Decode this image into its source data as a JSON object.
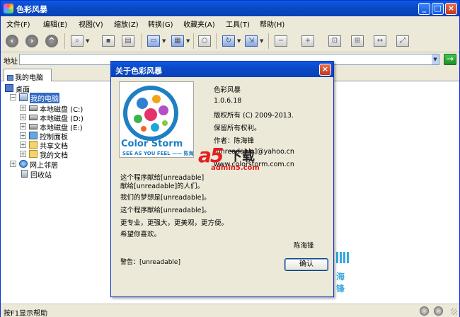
{
  "window": {
    "title": "色彩风暴"
  },
  "menu": [
    "文件(F)",
    "编辑(E)",
    "视图(V)",
    "缩放(Z)",
    "转换(G)",
    "收藏夹(A)",
    "工具(T)",
    "帮助(H)"
  ],
  "address": {
    "label": "地址",
    "value": "",
    "go_icon": "arrow-right-icon"
  },
  "tab": {
    "label": "我的电脑"
  },
  "tree": {
    "desktop": "桌面",
    "computer": "我的电脑",
    "drives": [
      "本地磁盘 (C:)",
      "本地磁盘 (D:)",
      "本地磁盘 (E:)"
    ],
    "control_panel": "控制面板",
    "shared_docs": "共享文档",
    "my_docs": "我的文档",
    "network": "网上邻居",
    "recycle": "回收站"
  },
  "status": {
    "text": "按F1显示帮助"
  },
  "dialog": {
    "title": "关于色彩风暴",
    "app_name": "色彩风暴",
    "version": "1.0.6.18",
    "copyright": "版权所有 (C) 2009-2013.",
    "rights": "保留所有权利。",
    "author": "作者：陈海锋",
    "email": "[unreadable]@yahoo.cn",
    "site": "www.colorstorm.com.cn",
    "logo_text": "Color Storm",
    "logo_slogan": "SEE AS YOU FEEL —— 陈海",
    "watermark_a5": "a5",
    "watermark_xz": "下载",
    "watermark_url": "admin5.com",
    "behind_logo_text": "海锋",
    "desc": [
      "这个程序献给[unreadable]",
      "献给[unreadable]的人们。",
      "我们的梦想是[unreadable]。",
      "这个程序献给[unreadable]。",
      "更专业，更强大，更美观，更方便。",
      "希望你喜欢。"
    ],
    "signature": "陈海锋",
    "legal": "警告：[unreadable]",
    "ok_label": "确认"
  },
  "colors": {
    "titlebar": "#0a49c9",
    "accent_red": "#e0211f",
    "logo_blue": "#1e7fc3",
    "chrome": "#ece9d8"
  }
}
